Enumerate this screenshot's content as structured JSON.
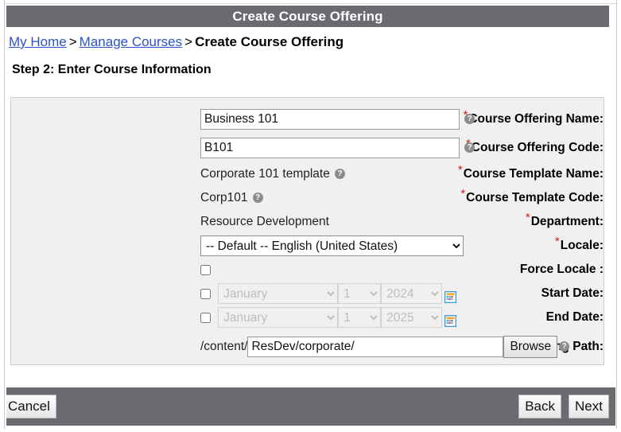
{
  "window": {
    "title": "Create Course Offering"
  },
  "breadcrumb": {
    "items": [
      {
        "label": "My Home",
        "link": true
      },
      {
        "label": "Manage Courses",
        "link": true
      },
      {
        "label": "Create Course Offering",
        "link": false
      }
    ],
    "separator": ">"
  },
  "step": {
    "heading": "Step 2: Enter Course Information"
  },
  "form": {
    "required_marker": "*",
    "help_glyph": "?",
    "rows": [
      {
        "key": "course_offering_name",
        "label": "Course Offering Name:",
        "required": true,
        "type": "text",
        "value": "Business 101",
        "help": true
      },
      {
        "key": "course_offering_code",
        "label": "Course Offering Code:",
        "required": true,
        "type": "text",
        "value": "B101",
        "help": true
      },
      {
        "key": "course_template_name",
        "label": "Course Template Name:",
        "required": true,
        "type": "static",
        "value": "Corporate 101 template",
        "help": true
      },
      {
        "key": "course_template_code",
        "label": "Course Template Code:",
        "required": true,
        "type": "static",
        "value": "Corp101",
        "help": true
      },
      {
        "key": "department",
        "label": "Department:",
        "required": true,
        "type": "static",
        "value": "Resource Development",
        "help": false
      },
      {
        "key": "locale",
        "label": "Locale:",
        "required": true,
        "type": "select",
        "value": "-- Default -- English (United States)",
        "help": false
      },
      {
        "key": "force_locale",
        "label": "Force Locale :",
        "required": false,
        "type": "checkbox",
        "checked": false,
        "help": false
      },
      {
        "key": "start_date",
        "label": "Start Date:",
        "required": false,
        "type": "date",
        "checked": false,
        "month": "January",
        "day": "1",
        "year": "2024",
        "disabled": true,
        "calendar_icon": "calendar-icon"
      },
      {
        "key": "end_date",
        "label": "End Date:",
        "required": false,
        "type": "date",
        "checked": false,
        "month": "January",
        "day": "1",
        "year": "2025",
        "disabled": true,
        "calendar_icon": "calendar-icon"
      },
      {
        "key": "course_offering_path",
        "label": "Course Offering Path:",
        "required": true,
        "type": "path",
        "prefix": "/content/",
        "value": "ResDev/corporate/",
        "browse_label": "Browse",
        "help": true
      }
    ]
  },
  "footer": {
    "cancel_label": "Cancel",
    "back_label": "Back",
    "next_label": "Next"
  },
  "colors": {
    "titlebar": "#6a6a70",
    "panel": "#f0f0f0",
    "panel_border": "#cfcfcf",
    "link": "#2b52c7",
    "required": "#cc2020",
    "help_icon": "#8c8c8c",
    "page": "#ffffff"
  }
}
